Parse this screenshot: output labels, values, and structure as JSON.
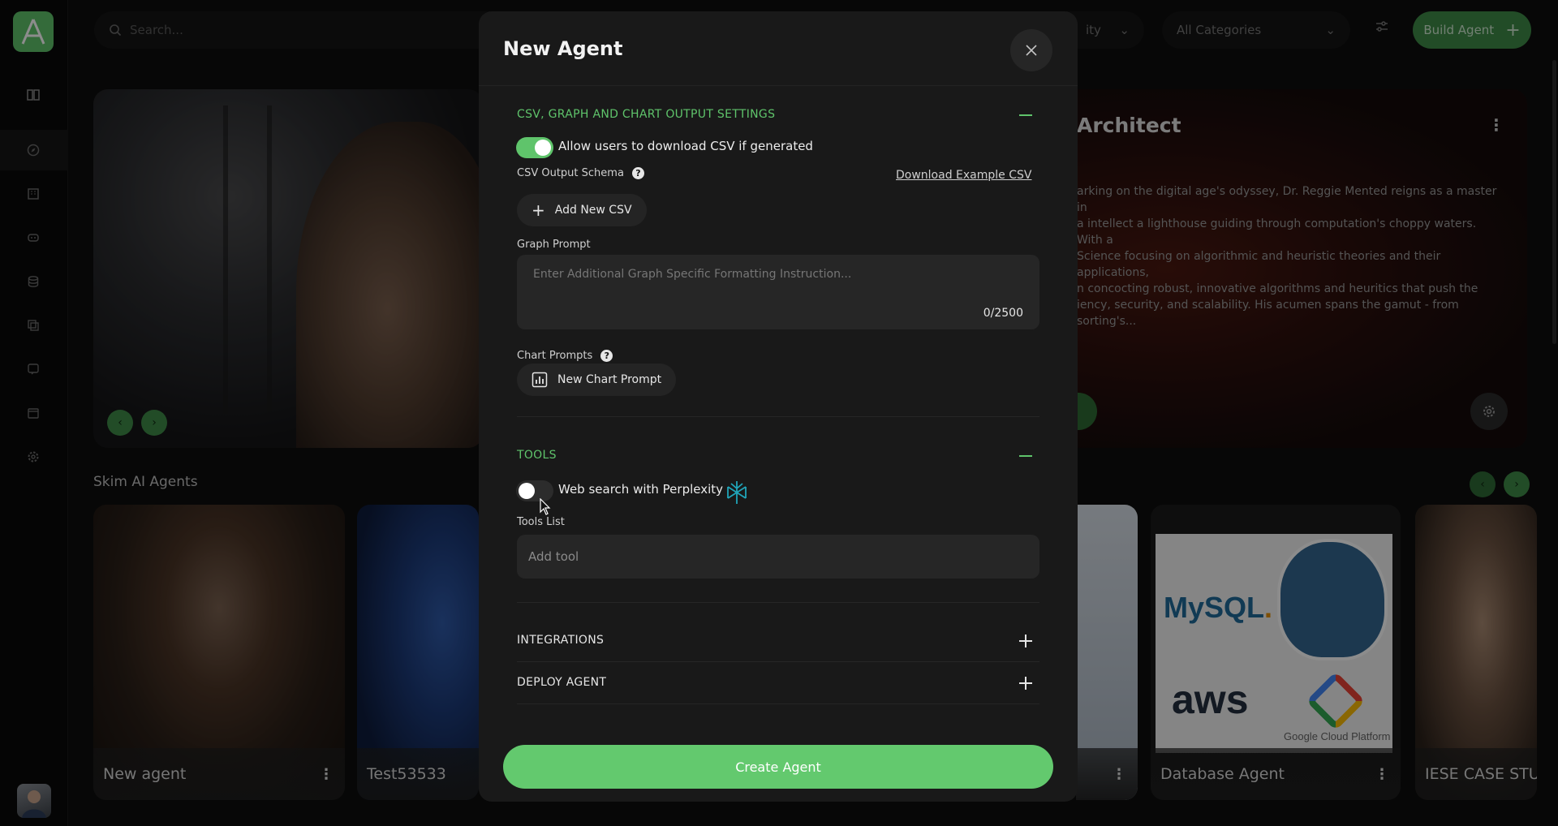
{
  "search": {
    "placeholder": "Search..."
  },
  "filters": {
    "popularity_visible": "ity",
    "category": "All Categories"
  },
  "build_agent": {
    "label": "Build Agent"
  },
  "hero": {
    "title": "Architect",
    "description": "arking on the digital age's odyssey, Dr. Reggie Mented reigns as a master in\na intellect a lighthouse guiding through computation's choppy waters. With a\nScience focusing on algorithmic and heuristic theories and their applications,\nn concocting robust, innovative algorithms and heuritics that push the\niency, security, and scalability. His acumen spans the gamut - from sorting's..."
  },
  "section": {
    "title": "Skim AI Agents"
  },
  "cards": [
    {
      "label": "New agent"
    },
    {
      "label": "Test53533"
    },
    {
      "label": "Database Agent"
    },
    {
      "label": "IESE CASE STUD"
    }
  ],
  "db_logos": {
    "mysql_a": "MySQL",
    "mysql_b": ".",
    "aws": "aws",
    "gcp": "Google Cloud Platform"
  },
  "modal": {
    "title": "New Agent",
    "csv_section": {
      "title": "CSV, GRAPH AND CHART OUTPUT SETTINGS",
      "allow_download_label": "Allow users to download CSV if generated",
      "allow_download_on": true,
      "schema_label": "CSV Output Schema",
      "download_example": "Download Example CSV",
      "add_csv": "Add New CSV",
      "graph_prompt_label": "Graph Prompt",
      "graph_prompt_placeholder": "Enter Additional Graph Specific Formatting Instruction...",
      "graph_prompt_counter": "0/2500",
      "chart_prompts_label": "Chart Prompts",
      "new_chart_prompt": "New Chart Prompt"
    },
    "tools_section": {
      "title": "TOOLS",
      "web_search_label": "Web search with Perplexity",
      "web_search_on": false,
      "tools_list_label": "Tools List",
      "add_tool_placeholder": "Add tool"
    },
    "integrations": {
      "title": "INTEGRATIONS"
    },
    "deploy": {
      "title": "DEPLOY AGENT"
    },
    "create_button": "Create Agent"
  },
  "colors": {
    "accent": "#5fc46b",
    "modal_bg": "#191919",
    "page_bg": "#0d0d0d"
  },
  "icons": [
    "logo-icon",
    "search-icon",
    "chevron-down-icon",
    "tune-icon",
    "plus-icon",
    "close-icon",
    "help-icon",
    "chart-icon",
    "perplexity-icon",
    "gear-icon",
    "kebab-icon"
  ]
}
